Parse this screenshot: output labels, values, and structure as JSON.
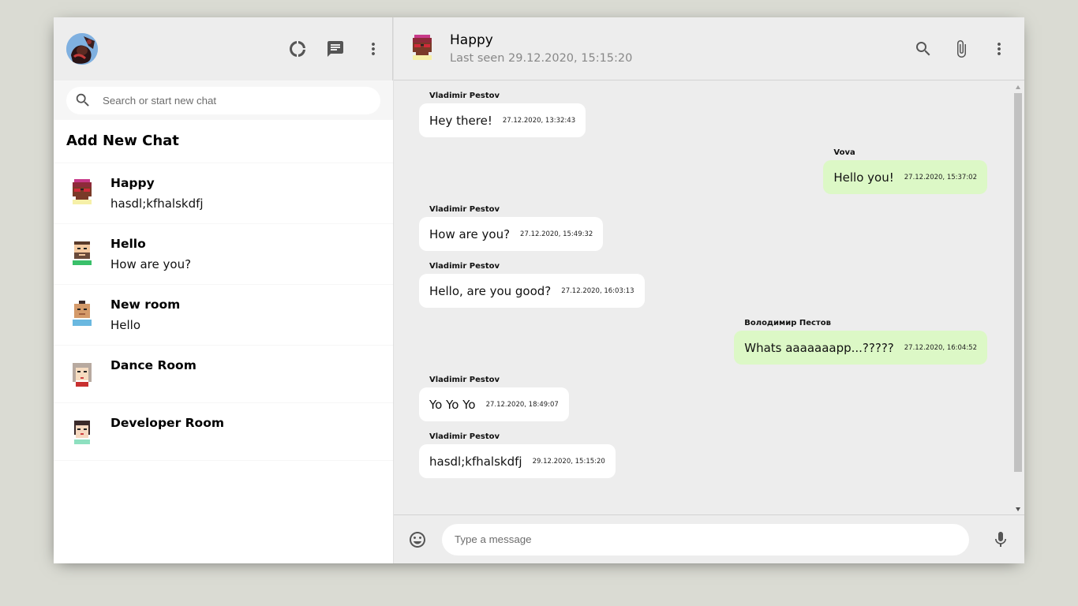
{
  "sidebar": {
    "search_placeholder": "Search or start new chat",
    "add_new_chat": "Add New Chat",
    "chats": [
      {
        "name": "Happy",
        "last_message": "hasdl;kfhalskdfj"
      },
      {
        "name": "Hello",
        "last_message": "How are you?"
      },
      {
        "name": "New room",
        "last_message": "Hello"
      },
      {
        "name": "Dance Room",
        "last_message": ""
      },
      {
        "name": "Developer Room",
        "last_message": ""
      }
    ]
  },
  "chat": {
    "room_name": "Happy",
    "last_seen": "Last seen 29.12.2020, 15:15:20",
    "messages": [
      {
        "author": "Vladimir Pestov",
        "text": "Hey there!",
        "time": "27.12.2020, 13:32:43",
        "mine": false
      },
      {
        "author": "Vova",
        "text": "Hello you!",
        "time": "27.12.2020, 15:37:02",
        "mine": true
      },
      {
        "author": "Vladimir Pestov",
        "text": "How are you?",
        "time": "27.12.2020, 15:49:32",
        "mine": false
      },
      {
        "author": "Vladimir Pestov",
        "text": "Hello, are you good?",
        "time": "27.12.2020, 16:03:13",
        "mine": false
      },
      {
        "author": "Володимир Пестов",
        "text": "Whats aaaaaaapp...?????",
        "time": "27.12.2020, 16:04:52",
        "mine": true
      },
      {
        "author": "Vladimir Pestov",
        "text": "Yo Yo Yo",
        "time": "27.12.2020, 18:49:07",
        "mine": false
      },
      {
        "author": "Vladimir Pestov",
        "text": "hasdl;kfhalskdfj",
        "time": "29.12.2020, 15:15:20",
        "mine": false
      }
    ],
    "input_placeholder": "Type a message"
  },
  "icons": {
    "status": "donut-large-icon",
    "new_chat": "chat-icon",
    "menu": "more-vert-icon",
    "search": "search-icon",
    "attach": "attach-file-icon",
    "emoji": "emoji-icon",
    "mic": "mic-icon"
  },
  "colors": {
    "outgoing_bubble": "#dcf8c6",
    "incoming_bubble": "#ffffff",
    "background": "#dadbd3",
    "panel": "#ededed"
  }
}
